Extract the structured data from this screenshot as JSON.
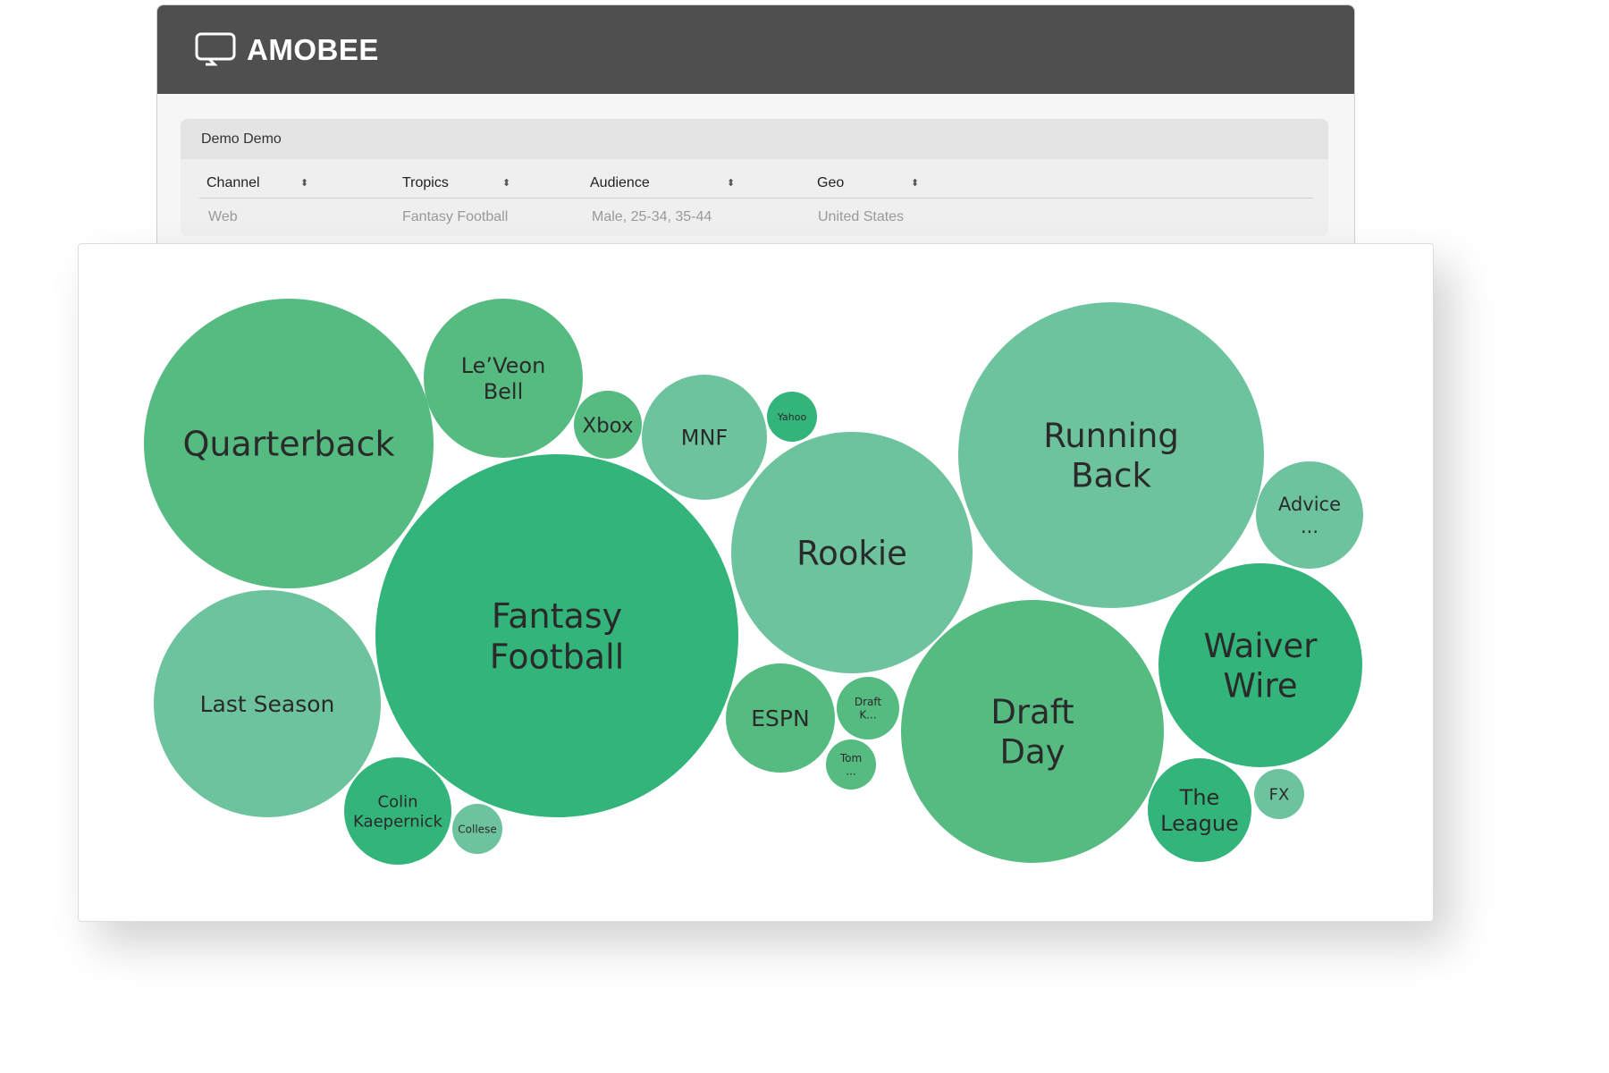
{
  "brand": {
    "name": "AMOBEE",
    "logo_icon": "monitor-icon"
  },
  "panel": {
    "title": "Demo Demo",
    "columns": [
      {
        "header": "Channel",
        "value": "Web",
        "sort_icon": "sort-icon"
      },
      {
        "header": "Tropics",
        "value": "Fantasy Football",
        "sort_icon": "sort-icon"
      },
      {
        "header": "Audience",
        "value": "Male, 25-34, 35-44",
        "sort_icon": "sort-icon"
      },
      {
        "header": "Geo",
        "value": "United States",
        "sort_icon": "sort-icon"
      }
    ]
  },
  "colors": {
    "dark": "#33b47a",
    "medium": "#55bb80",
    "light": "#6dc39e",
    "header": "#4f4f4f"
  },
  "bubbles": [
    {
      "label": "Quarterback",
      "lines": [
        "Quarterback"
      ],
      "tone": "medium"
    },
    {
      "label": "Le'Veon Bell",
      "lines": [
        "Le’Veon",
        "Bell"
      ],
      "tone": "medium"
    },
    {
      "label": "Xbox",
      "lines": [
        "Xbox"
      ],
      "tone": "medium"
    },
    {
      "label": "MNF",
      "lines": [
        "MNF"
      ],
      "tone": "light"
    },
    {
      "label": "Yahoo",
      "lines": [
        "Yahoo"
      ],
      "tone": "dark"
    },
    {
      "label": "Fantasy Football",
      "lines": [
        "Fantasy",
        "Football"
      ],
      "tone": "dark"
    },
    {
      "label": "Rookie",
      "lines": [
        "Rookie"
      ],
      "tone": "light"
    },
    {
      "label": "Running Back",
      "lines": [
        "Running",
        "Back"
      ],
      "tone": "light"
    },
    {
      "label": "Advice ...",
      "lines": [
        "Advice",
        "..."
      ],
      "tone": "light"
    },
    {
      "label": "Waiver Wire",
      "lines": [
        "Waiver",
        "Wire"
      ],
      "tone": "dark"
    },
    {
      "label": "Draft Day",
      "lines": [
        "Draft",
        "Day"
      ],
      "tone": "medium"
    },
    {
      "label": "The League",
      "lines": [
        "The",
        "League"
      ],
      "tone": "dark"
    },
    {
      "label": "FX",
      "lines": [
        "FX"
      ],
      "tone": "light"
    },
    {
      "label": "Last Season",
      "lines": [
        "Last Season"
      ],
      "tone": "light"
    },
    {
      "label": "Colin Kaepernick",
      "lines": [
        "Colin",
        "Kaepernick"
      ],
      "tone": "dark"
    },
    {
      "label": "Collese",
      "lines": [
        "Collese"
      ],
      "tone": "light"
    },
    {
      "label": "ESPN",
      "lines": [
        "ESPN"
      ],
      "tone": "medium"
    },
    {
      "label": "Draft K...",
      "lines": [
        "Draft",
        "K..."
      ],
      "tone": "medium"
    },
    {
      "label": "Tom ...",
      "lines": [
        "Tom",
        "..."
      ],
      "tone": "medium"
    }
  ]
}
